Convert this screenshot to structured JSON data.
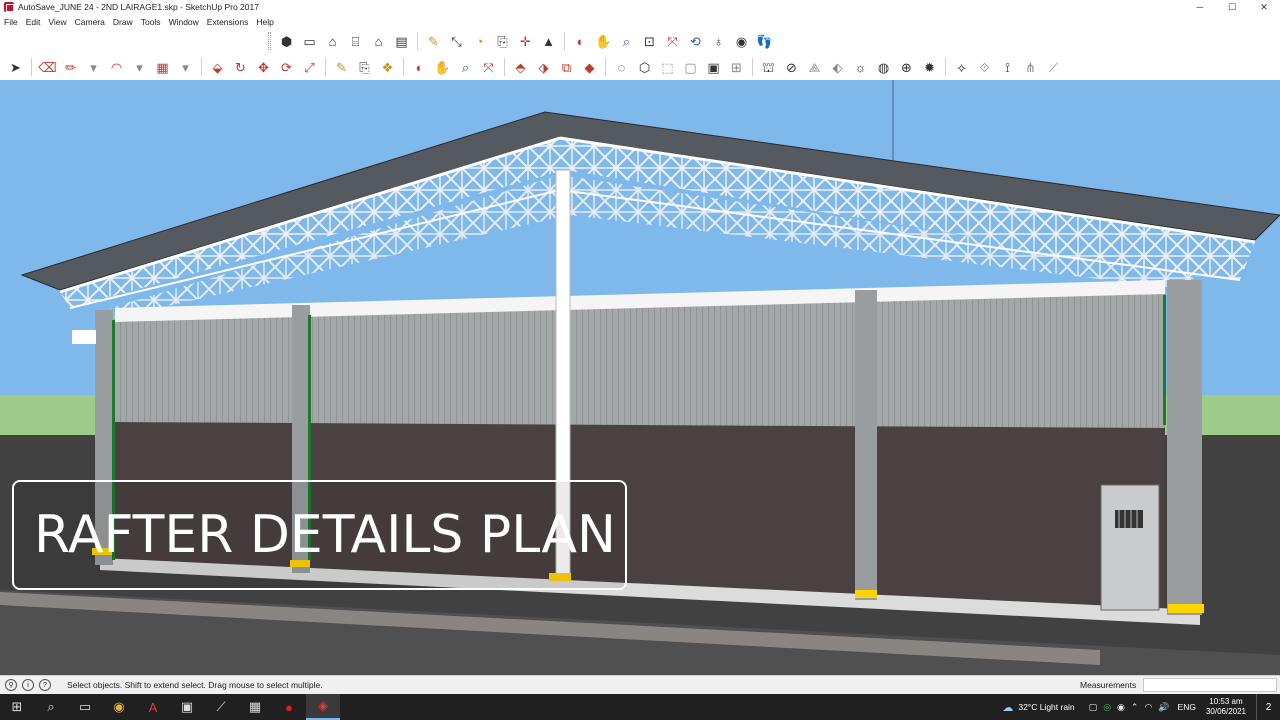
{
  "window": {
    "title": "AutoSave_JUNE 24 - 2ND LAIRAGE1.skp - SketchUp Pro 2017",
    "controls": {
      "minimize": "─",
      "maximize": "☐",
      "close": "✕"
    }
  },
  "menu": [
    "File",
    "Edit",
    "View",
    "Camera",
    "Draw",
    "Tools",
    "Window",
    "Extensions",
    "Help"
  ],
  "toolbar_top": [
    "iso-view-icon",
    "top-view-icon",
    "front-view-icon",
    "right-view-icon",
    "back-view-icon",
    "left-view-icon",
    "bottom-view-icon",
    "tape-measure-icon",
    "dimension-icon",
    "protractor-icon",
    "text-icon",
    "axes-icon",
    "3d-text-icon",
    "orbit-icon",
    "pan-icon",
    "zoom-icon",
    "zoom-window-icon",
    "zoom-extents-icon",
    "previous-view-icon",
    "position-camera-icon",
    "look-around-icon",
    "walk-icon"
  ],
  "toolbar_main": [
    "select-icon",
    "eraser-icon",
    "line-icon",
    "arc-icon",
    "rectangle-icon",
    "push-pull-icon",
    "follow-me-icon",
    "move-icon",
    "rotate-icon",
    "scale-icon",
    "offset-icon",
    "tape-icon",
    "paint-bucket-icon",
    "orbit-icon",
    "pan-icon",
    "zoom-icon",
    "zoom-extents-icon",
    "warehouse-icon",
    "share-model-icon",
    "extension-warehouse-icon",
    "ruby-icon",
    "xray-icon",
    "back-edges-icon",
    "wireframe-icon",
    "hidden-line-icon",
    "shaded-icon",
    "textured-icon",
    "monochrome-icon",
    "section-plane-icon",
    "shadows-icon",
    "fog-icon",
    "sandbox-icon"
  ],
  "overlay": {
    "text": "RAFTER DETAILS PLAN"
  },
  "status": {
    "message": "Select objects. Shift to extend select. Drag mouse to select multiple.",
    "measurements_label": "Measurements",
    "measurements_value": ""
  },
  "taskbar": {
    "weather": "32°C  Light rain",
    "language": "ENG",
    "time": "10:53 am",
    "date": "30/06/2021",
    "notifications": "2"
  },
  "colors": {
    "sky": "#7fb8ea",
    "ground": "#414141",
    "grass": "#9ecb8a",
    "wall_lower": "#4a4143",
    "wall_upper": "#a4a7a8",
    "accent_yellow": "#ffd400",
    "roof": "#555a60"
  }
}
